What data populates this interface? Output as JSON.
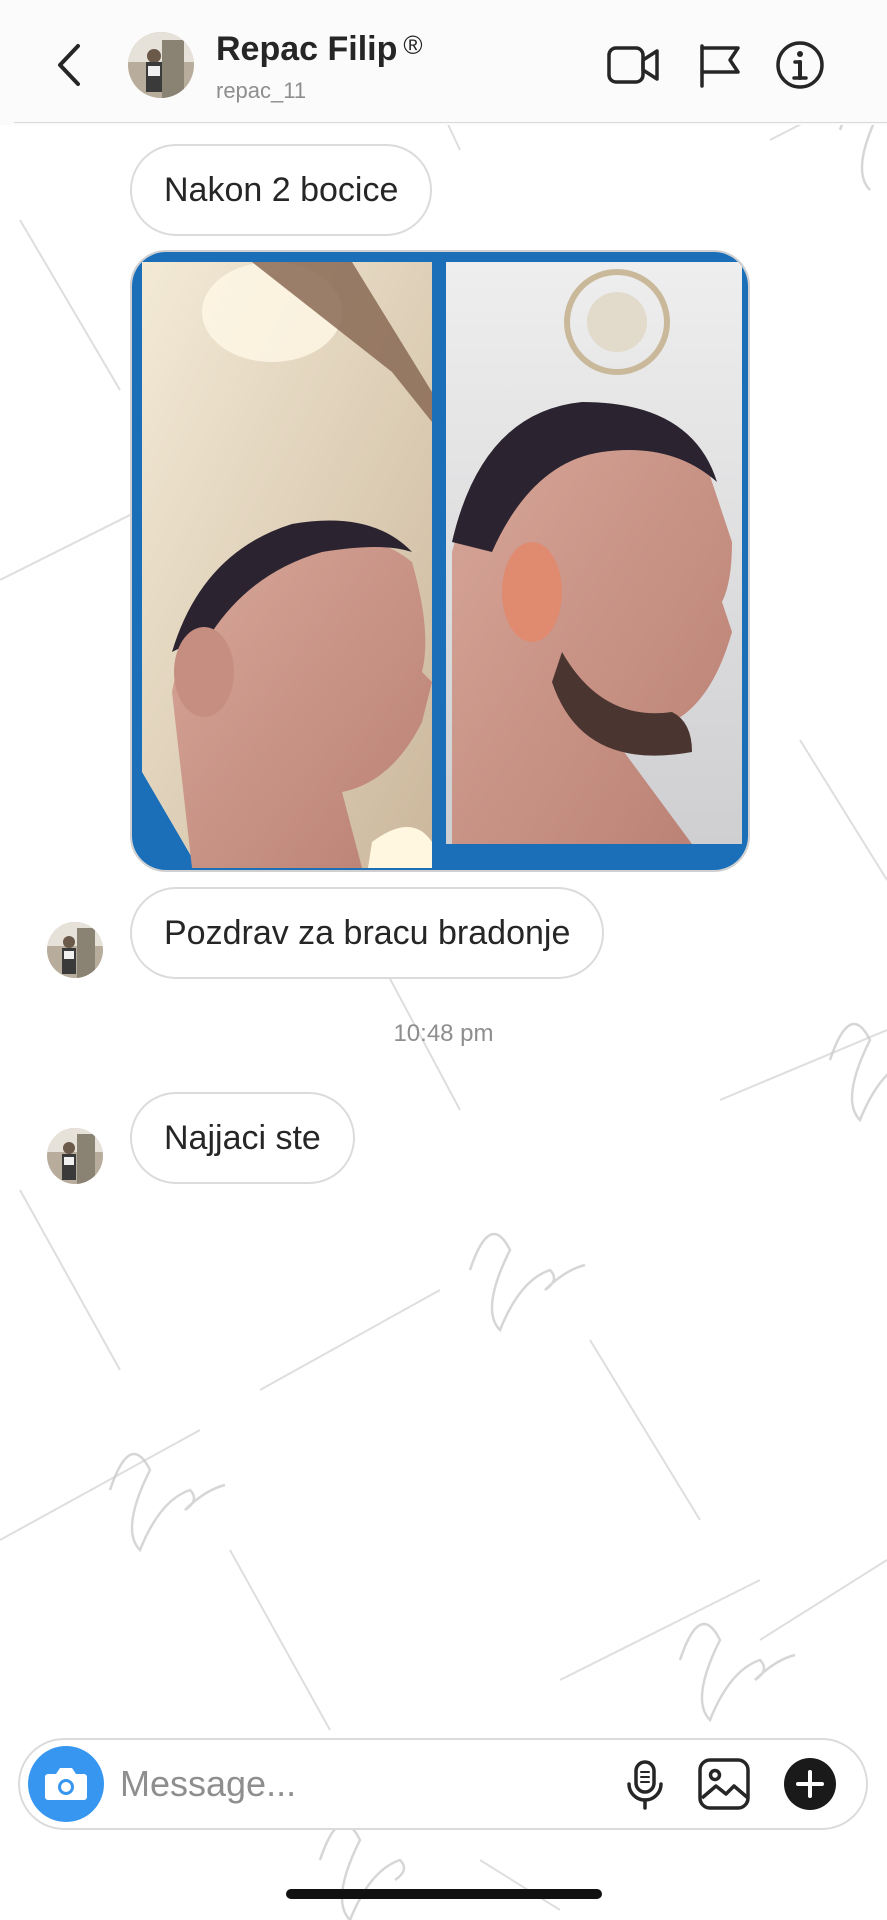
{
  "header": {
    "name": "Repac Filip",
    "registered_mark": "®",
    "handle": "repac_11",
    "icons": {
      "back": "chevron-left-icon",
      "video": "video-camera-icon",
      "flag": "flag-icon",
      "info": "info-icon"
    }
  },
  "messages": [
    {
      "type": "text",
      "text": "Nakon 2 bocice"
    },
    {
      "type": "image",
      "description_icon": "photo-collage"
    },
    {
      "type": "text",
      "text": "Pozdrav za bracu bradonje"
    },
    {
      "type": "timestamp",
      "text": "10:48 pm"
    },
    {
      "type": "text",
      "text": "Najjaci ste"
    }
  ],
  "composer": {
    "placeholder": "Message...",
    "icons": {
      "camera": "camera-icon",
      "mic": "microphone-icon",
      "gallery": "image-gallery-icon",
      "plus": "plus-icon"
    }
  },
  "colors": {
    "accent_blue": "#3797f0",
    "photo_frame_blue": "#1a6fb8",
    "bubble_border": "#dbdbdb",
    "secondary_text": "#8e8e8e"
  }
}
